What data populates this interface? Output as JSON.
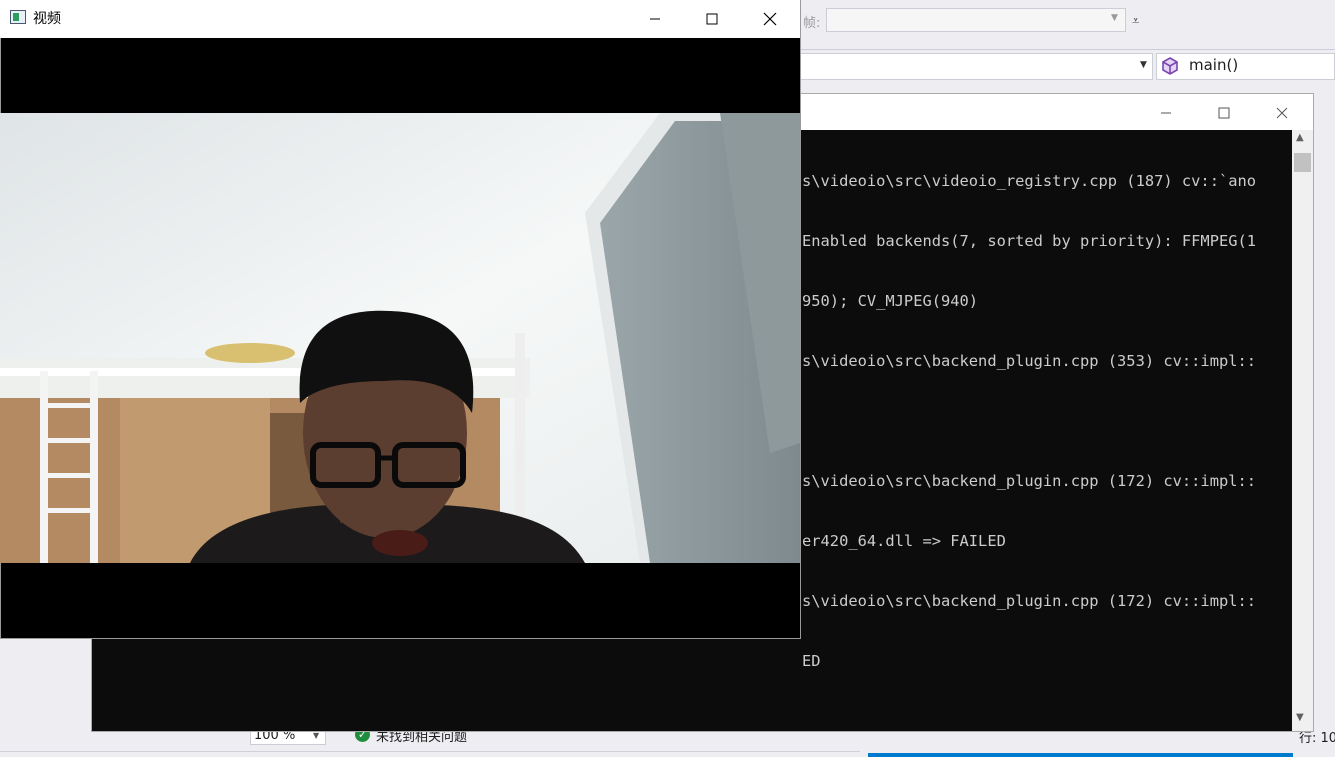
{
  "ide": {
    "frame_label": "帧:",
    "function_nav": "main()",
    "zoom": "100 %",
    "issues_text": "未找到相关问题",
    "line_indicator": "行: 10"
  },
  "console_window": {
    "lines": [
      "s\\videoio\\src\\videoio_registry.cpp (187) cv::`ano",
      "Enabled backends(7, sorted by priority): FFMPEG(1",
      "950); CV_MJPEG(940)",
      "s\\videoio\\src\\backend_plugin.cpp (353) cv::impl::",
      "",
      "s\\videoio\\src\\backend_plugin.cpp (172) cv::impl::",
      "er420_64.dll => FAILED",
      "s\\videoio\\src\\backend_plugin.cpp (172) cv::impl::",
      "ED"
    ]
  },
  "video_window": {
    "title": "视频"
  },
  "icons": {
    "minimize": "minimize-icon",
    "maximize": "maximize-icon",
    "close": "close-icon",
    "function": "cube-icon",
    "issues": "checkmark-icon"
  },
  "colors": {
    "accent": "#007acc",
    "console_bg": "#0c0c0c",
    "console_fg": "#cccccc",
    "ok_green": "#1e8e3e"
  }
}
